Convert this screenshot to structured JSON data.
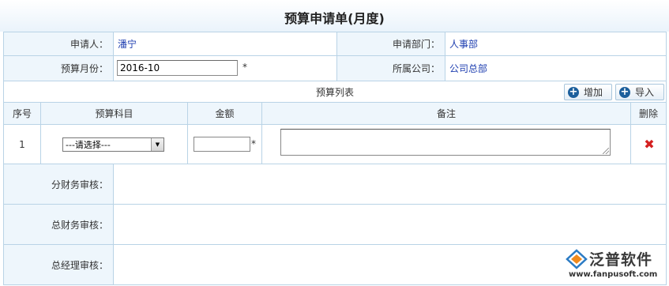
{
  "form": {
    "title": "预算申请单(月度)",
    "applicant_label": "申请人：",
    "applicant_value": "潘宁",
    "department_label": "申请部门：",
    "department_value": "人事部",
    "month_label": "预算月份：",
    "month_value": "2016-10",
    "required_mark": "*",
    "company_label": "所属公司：",
    "company_value": "公司总部"
  },
  "budget_list": {
    "title": "预算列表",
    "add_button": "增加",
    "import_button": "导入",
    "columns": [
      "序号",
      "预算科目",
      "金额",
      "备注",
      "删除"
    ],
    "rows": [
      {
        "index": "1",
        "subject_selected": "---请选择---",
        "amount": "",
        "amount_required": "*",
        "remark": ""
      }
    ]
  },
  "reviews": [
    {
      "label": "分财务审核：",
      "value": ""
    },
    {
      "label": "总财务审核：",
      "value": ""
    },
    {
      "label": "总经理审核：",
      "value": ""
    }
  ],
  "watermark": {
    "brand": "泛普软件",
    "url": "www.fanpusoft.com"
  },
  "colors": {
    "border": "#b9d3e6",
    "label_bg": "#eef6fc",
    "value_text": "#1f3fb0",
    "delete_icon": "#d42020",
    "button_icon": "#1c5f9c"
  },
  "icons": {
    "add": "plus-circle-icon",
    "import": "plus-circle-icon",
    "delete": "red-x-icon",
    "dropdown": "triangle-down-icon"
  }
}
